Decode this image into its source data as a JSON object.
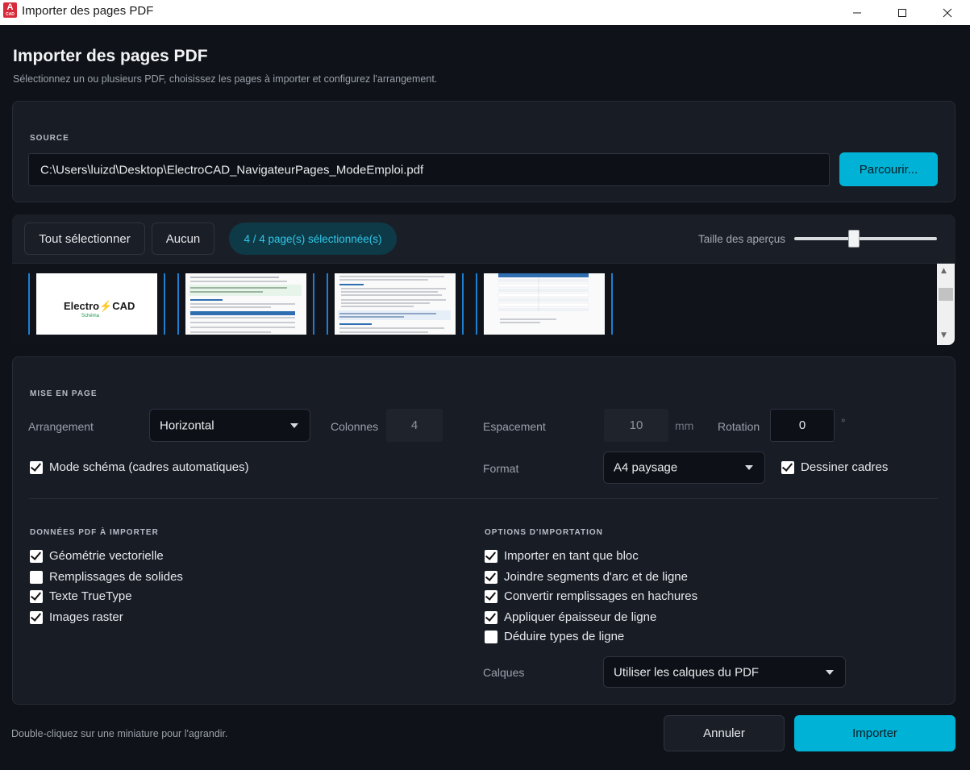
{
  "window": {
    "title": "Importer des pages PDF",
    "icon_letter": "A",
    "icon_sub": "CAD"
  },
  "header": {
    "title": "Importer des pages PDF",
    "subtitle": "Sélectionnez un ou plusieurs PDF, choisissez les pages à importer et configurez l'arrangement."
  },
  "source": {
    "label": "SOURCE",
    "path": "C:\\Users\\luizd\\Desktop\\ElectroCAD_NavigateurPages_ModeEmploi.pdf",
    "browse_label": "Parcourir..."
  },
  "pages_toolbar": {
    "select_all_label": "Tout sélectionner",
    "none_label": "Aucun",
    "count_label": "4 / 4 page(s) sélectionnée(s)",
    "thumb_size_label": "Taille des aperçus",
    "thumb_size_value": 0.42
  },
  "thumbnails": {
    "logo_text_a": "Electro",
    "logo_text_b": "CAD",
    "logo_sub": "Schéma"
  },
  "layout": {
    "label": "MISE EN PAGE",
    "arrangement_label": "Arrangement",
    "arrangement_value": "Horizontal",
    "columns_label": "Colonnes",
    "columns_value": "4",
    "spacing_label": "Espacement",
    "spacing_value": "10",
    "spacing_unit": "mm",
    "rotation_label": "Rotation",
    "rotation_value": "0",
    "rotation_unit": "°",
    "schema_mode_label": "Mode schéma (cadres automatiques)",
    "format_label": "Format",
    "format_value": "A4 paysage",
    "draw_frames_label": "Dessiner cadres"
  },
  "pdf_data": {
    "label": "DONNÉES PDF À IMPORTER",
    "items": [
      {
        "label": "Géométrie vectorielle",
        "checked": true
      },
      {
        "label": "Remplissages de solides",
        "checked": false
      },
      {
        "label": "Texte TrueType",
        "checked": true
      },
      {
        "label": "Images raster",
        "checked": true
      }
    ]
  },
  "import_options": {
    "label": "OPTIONS D'IMPORTATION",
    "items": [
      {
        "label": "Importer en tant que bloc",
        "checked": true
      },
      {
        "label": "Joindre segments d'arc et de ligne",
        "checked": true
      },
      {
        "label": "Convertir remplissages en hachures",
        "checked": true
      },
      {
        "label": "Appliquer épaisseur de ligne",
        "checked": true
      },
      {
        "label": "Déduire types de ligne",
        "checked": false
      }
    ],
    "layers_label": "Calques",
    "layers_value": "Utiliser les calques du PDF"
  },
  "footer": {
    "hint": "Double-cliquez sur une miniature pour l'agrandir.",
    "cancel_label": "Annuler",
    "import_label": "Importer"
  }
}
